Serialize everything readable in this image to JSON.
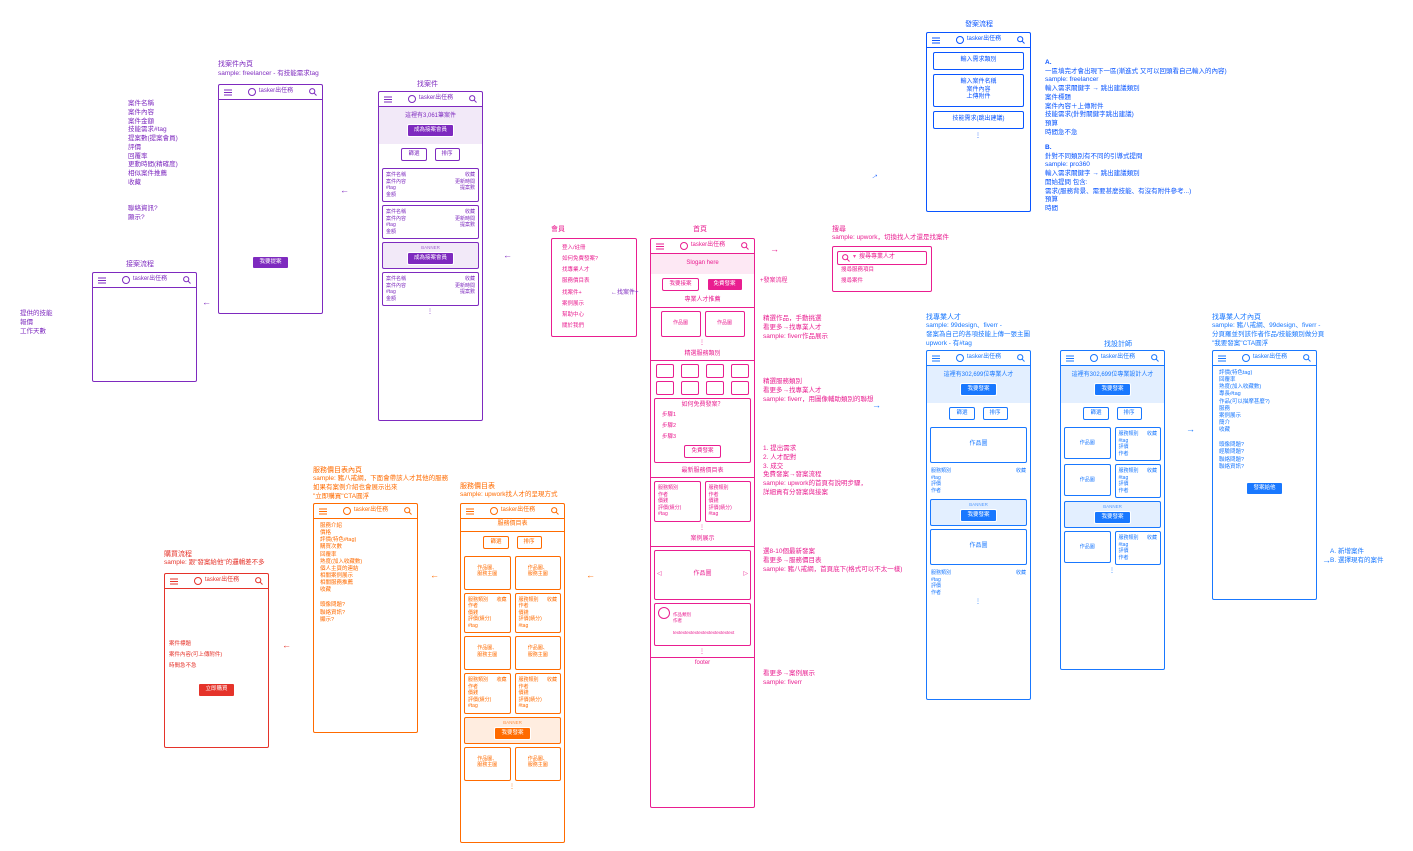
{
  "brand": "tasker出任務",
  "dots": "⋮",
  "titles": {
    "home": "首頁",
    "publish_flow": "發案流程",
    "search": "搜尋",
    "find_pro": "找專業人才",
    "find_designer": "找設計師",
    "find_pro_detail": "找專業人才內頁",
    "find_case": "找案件",
    "find_case_detail": "找案件內頁",
    "accept_flow": "接案流程",
    "svc_list": "服務價目表",
    "svc_list_detail": "服務價目表內頁",
    "buy_flow": "購買流程",
    "footer": "會員",
    "hp_pro": "專業人才推薦",
    "hp_cat": "精選服務類別",
    "hp_steps": "如何免費發案？",
    "hp_latest": "最新服務價目表",
    "hp_showcase": "案例展示",
    "footer_lbl": "footer"
  },
  "home": {
    "slogan": "Slogan here",
    "btn_accept": "我要接案",
    "btn_publish": "免費發案",
    "steps": {
      "s1": "步驟1",
      "s2": "步驟2",
      "s3": "步驟3"
    },
    "btn_publish2": "免費發案",
    "work_thumb": "作品圖",
    "svc": {
      "cat": "服務類別",
      "author": "作者",
      "price": "價錢",
      "rating": "評價(績分)",
      "tag": "#tag"
    }
  },
  "footer_menu": [
    "登入/註冊",
    "如何免費發案?",
    "找專業人才",
    "服務價目表",
    "找案件+",
    "案例展示",
    "幫助中心",
    "關於我們"
  ],
  "search": {
    "placeholder": "搜尋專業人才",
    "opt1": "搜尋服務項目",
    "opt2": "搜尋案件"
  },
  "publish": {
    "f1": "輸入需求類別",
    "f2_a": "輸入案件名稱",
    "f2_b": "案件內容",
    "f2_c": "上傳附件",
    "f3": "技能需求(跳出建議)"
  },
  "find_pro": {
    "count": "這裡有302,699位專業人才",
    "count_designer": "這裡有302,699位專業設計人才",
    "cta": "我要發案",
    "filter": "篩選",
    "sort": "排序",
    "work": "作品圖",
    "meta": {
      "cat": "服務類別",
      "tag": "#tag",
      "rating": "評價",
      "author": "作者",
      "fav": "收藏"
    }
  },
  "find_pro_detail_cta": "發案給他",
  "find_case": {
    "count": "這裡有3,061筆案件",
    "cta": "成為接案會員",
    "filter": "篩選",
    "sort": "排序",
    "item": {
      "name": "案件名稱",
      "content": "案件內容",
      "tag": "#tag",
      "price": "金額",
      "fav": "收藏",
      "upd": "更新時間",
      "bids": "提案數"
    },
    "banner_cta": "成為接案會員",
    "detail_cta": "我要提案"
  },
  "svc": {
    "header": "服務價目表",
    "filter": "篩選",
    "sort": "排序",
    "thumb": "作品圖、\n服務主圖",
    "meta": {
      "cat": "服務類別",
      "author": "作者",
      "price": "價錢",
      "rating": "評價(績分)",
      "tag": "#tag",
      "fav": "收藏"
    },
    "banner_cta": "我要發案"
  },
  "svc_detail_cta": "立即購買",
  "buy": {
    "l1": "案件標題",
    "l2": "案件內容(可上傳附件)",
    "l3": "時間急不急"
  },
  "banner_label": "BANNER",
  "notes": {
    "search_note": "sample: upwork，切換找人才還是找案件",
    "publish_a_title": "A.",
    "publish_a": "一區填完才會出現下一區(漸進式 又可以回頭看自己輸入的內容)\nsample: freelancer\n輸入需求關鍵字 → 跳出建議類別\n案件標題\n案件內容＋上傳附件\n技能需求(針對關鍵字跳出建議)\n預算\n時間急不急",
    "publish_b_title": "B.",
    "publish_b": "針對不同類別有不同的引導式提問\nsample: pro360\n輸入需求關鍵字 → 跳出建議類別\n開始提問 包含:\n需求(服務背景、需要甚麼技能、有沒有附件參考...)\n預算\n時間",
    "hp_pro_note": "精選作品，手動挑選\n看更多→找專業人才\nsample: fiverr作品展示",
    "hp_cat_note": "精選服務類別\n看更多→找專業人才\nsample: fiverr，用圖像輔助類別的聯想",
    "hp_steps_note": "1. 提出需求\n2. 人才配對\n3. 成交\n免費發案→發案流程\nsample: upwork的首頁有說明步驟，\n詳細貢有分發案與接案",
    "hp_latest_note": "選8-10個最新發案\n看更多→服務價目表\nsample: 豬八戒網，首頁底下(格式可以不太一樣)",
    "hp_showcase_note": "看更多→案例展示\nsample: fiverr",
    "find_pro_h": "sample: 99design、fiverr -\n發案為自己的各項技能上傳一張主圖\nupwork - 有#tag",
    "find_pro_detail_h": "sample: 豬八戒網、99design、fiverr -\n分頁羅並列該作者作品/技能類別做分頁\n\"我要發案\"CTA圓浮",
    "find_pro_detail_list": "評價(特色tag)\n回覆率\n熟度(加入收藏數)\n專長#tag\n作品(可以描摩甚麼?)\n服務\n案例展示\n簡介\n收藏",
    "find_pro_detail_q": "頭像問題?\n經驗問題?\n聯絡問題?\n聯絡資訊?",
    "find_pro_detail_cta_note": "A. 新增案件\nB. 選擇現有的案件",
    "find_case_h": "sample: freelancer - 有技能需求tag",
    "find_case_list": "案件名稱\n案件內容\n案件金額\n技能需求#tag\n提案數(提案會員)\n評價\n回覆率\n更動時間(精確度)\n相似案件推薦\n收藏",
    "find_case_q": "聯絡資訊?\n顯示?",
    "accept_list": "提供的技能\n報價\n工作天數",
    "svc_h": "sample: upwork找人才的呈現方式",
    "svc_detail_h": "sample: 豬八戒網，下面會帶該人才其他的服務\n如果有案例介紹也會展示出來\n\"立即購買\"CTA圓浮",
    "svc_detail_list": "服務介紹\n價格\n評價(特色#tag)\n購買次數\n回覆率\n熟度(加入收藏數)\n個人主頁的連結\n相關案例展示\n相關服務推薦\n收藏",
    "svc_detail_q": "頭像問題?\n聯絡資訊?\n顯示?",
    "buy_h": "sample: 跟\"發案給他\"的邏輯差不多"
  },
  "arrows": {
    "left": "←",
    "right": "→",
    "leftlabel": "←找案件+",
    "rightlabel": "+發案流程"
  },
  "showcase": {
    "meta": "作品類別\n作者",
    "text": "textextextextextextextextextext"
  }
}
